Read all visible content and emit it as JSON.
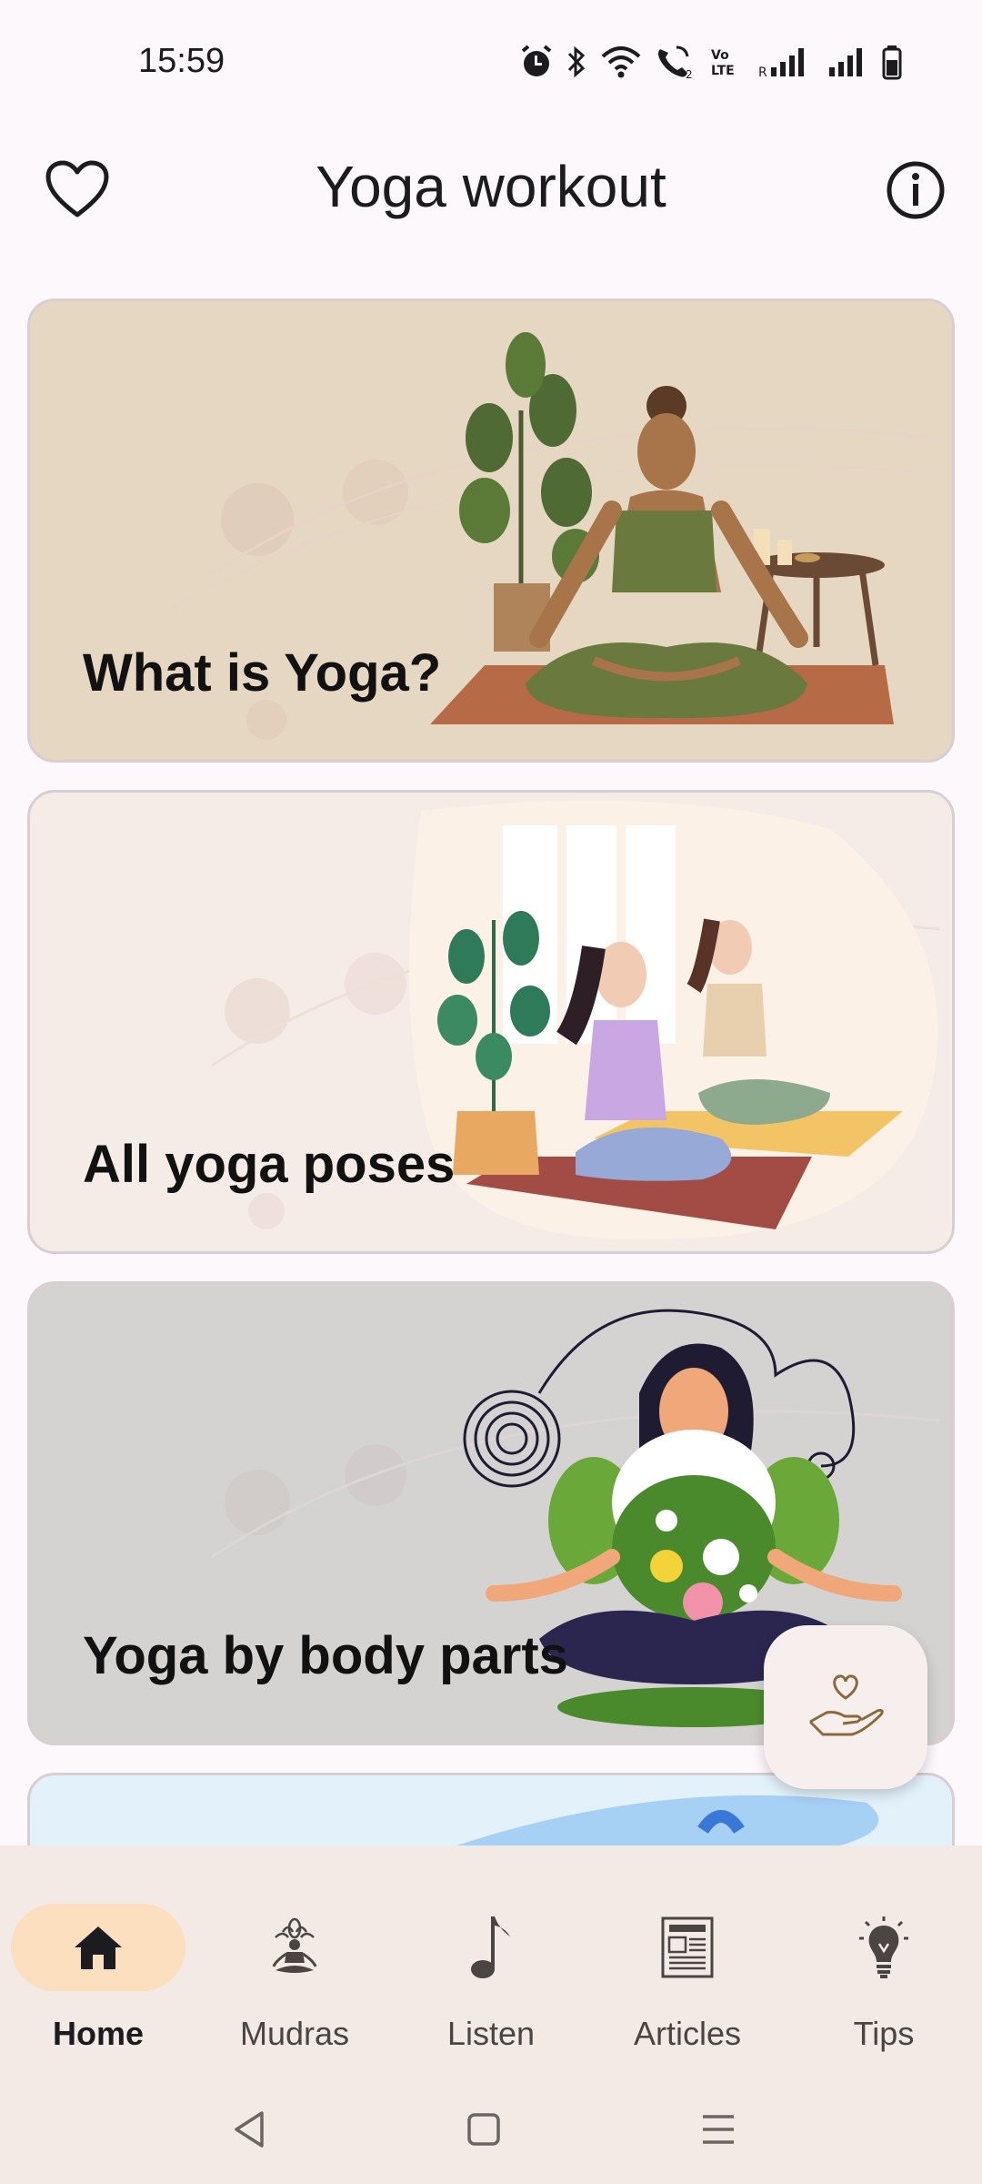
{
  "status_bar": {
    "time": "15:59",
    "icons": [
      "alarm-icon",
      "bluetooth-icon",
      "wifi-icon",
      "wifi-call-icon",
      "volte-icon",
      "signal-icon",
      "signal-icon",
      "battery-icon"
    ],
    "volte_text": "Vo LTE"
  },
  "app_bar": {
    "title": "Yoga workout",
    "left_icon": "heart-outline-icon",
    "right_icon": "info-icon"
  },
  "cards": [
    {
      "title": "What is Yoga?",
      "background": "#e6d7c3"
    },
    {
      "title": "All yoga poses",
      "background": "#f5ece8"
    },
    {
      "title": "Yoga by body parts",
      "background": "#d5d3d1"
    },
    {
      "title": "",
      "background": "#e3f1fb"
    }
  ],
  "fab": {
    "icon": "hand-heart-icon"
  },
  "bottom_nav": {
    "items": [
      {
        "label": "Home",
        "icon": "home-icon",
        "active": true
      },
      {
        "label": "Mudras",
        "icon": "lotus-meditation-icon",
        "active": false
      },
      {
        "label": "Listen",
        "icon": "music-note-icon",
        "active": false
      },
      {
        "label": "Articles",
        "icon": "newspaper-icon",
        "active": false
      },
      {
        "label": "Tips",
        "icon": "lightbulb-icon",
        "active": false
      }
    ],
    "active_color": "#fbdfbe"
  },
  "system_nav": [
    "back-icon",
    "home-square-icon",
    "menu-icon"
  ]
}
